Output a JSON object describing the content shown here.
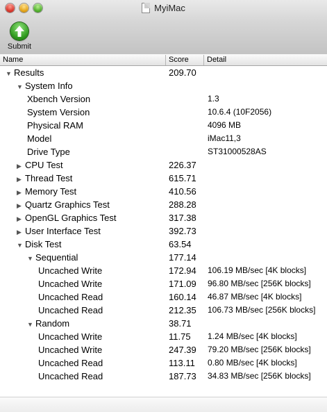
{
  "window": {
    "title": "MyiMac"
  },
  "toolbar": {
    "submit_label": "Submit"
  },
  "columns": {
    "name": "Name",
    "score": "Score",
    "detail": "Detail"
  },
  "rows": [
    {
      "label": "Results",
      "score": "209.70",
      "detail": "",
      "toggle": "open"
    },
    {
      "label": "System Info",
      "score": "",
      "detail": "",
      "toggle": "open"
    },
    {
      "label": "Xbench Version",
      "score": "",
      "detail": "1.3",
      "toggle": ""
    },
    {
      "label": "System Version",
      "score": "",
      "detail": "10.6.4 (10F2056)",
      "toggle": ""
    },
    {
      "label": "Physical RAM",
      "score": "",
      "detail": "4096 MB",
      "toggle": ""
    },
    {
      "label": "Model",
      "score": "",
      "detail": "iMac11,3",
      "toggle": ""
    },
    {
      "label": "Drive Type",
      "score": "",
      "detail": "ST31000528AS",
      "toggle": ""
    },
    {
      "label": "CPU Test",
      "score": "226.37",
      "detail": "",
      "toggle": "closed"
    },
    {
      "label": "Thread Test",
      "score": "615.71",
      "detail": "",
      "toggle": "closed"
    },
    {
      "label": "Memory Test",
      "score": "410.56",
      "detail": "",
      "toggle": "closed"
    },
    {
      "label": "Quartz Graphics Test",
      "score": "288.28",
      "detail": "",
      "toggle": "closed"
    },
    {
      "label": "OpenGL Graphics Test",
      "score": "317.38",
      "detail": "",
      "toggle": "closed"
    },
    {
      "label": "User Interface Test",
      "score": "392.73",
      "detail": "",
      "toggle": "closed"
    },
    {
      "label": "Disk Test",
      "score": "63.54",
      "detail": "",
      "toggle": "open"
    },
    {
      "label": "Sequential",
      "score": "177.14",
      "detail": "",
      "toggle": "open"
    },
    {
      "label": "Uncached Write",
      "score": "172.94",
      "detail": "106.19 MB/sec [4K blocks]",
      "toggle": ""
    },
    {
      "label": "Uncached Write",
      "score": "171.09",
      "detail": "96.80 MB/sec [256K blocks]",
      "toggle": ""
    },
    {
      "label": "Uncached Read",
      "score": "160.14",
      "detail": "46.87 MB/sec [4K blocks]",
      "toggle": ""
    },
    {
      "label": "Uncached Read",
      "score": "212.35",
      "detail": "106.73 MB/sec [256K blocks]",
      "toggle": ""
    },
    {
      "label": "Random",
      "score": "38.71",
      "detail": "",
      "toggle": "open"
    },
    {
      "label": "Uncached Write",
      "score": "11.75",
      "detail": "1.24 MB/sec [4K blocks]",
      "toggle": ""
    },
    {
      "label": "Uncached Write",
      "score": "247.39",
      "detail": "79.20 MB/sec [256K blocks]",
      "toggle": ""
    },
    {
      "label": "Uncached Read",
      "score": "113.11",
      "detail": "0.80 MB/sec [4K blocks]",
      "toggle": ""
    },
    {
      "label": "Uncached Read",
      "score": "187.73",
      "detail": "34.83 MB/sec [256K blocks]",
      "toggle": ""
    }
  ]
}
